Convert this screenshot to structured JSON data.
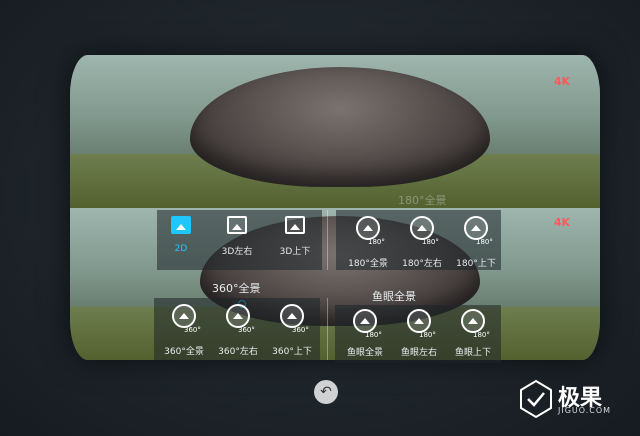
{
  "video": {
    "badge_top": "4K",
    "badge_bottom": "4K"
  },
  "menu_2d_3d": {
    "items": [
      {
        "label": "2D",
        "active": true
      },
      {
        "label": "3D左右",
        "active": false
      },
      {
        "label": "3D上下",
        "active": false
      }
    ]
  },
  "menu_180": {
    "ghost_title": "180°全景",
    "items": [
      {
        "label": "180°全景",
        "icon_tag": "180°"
      },
      {
        "label": "180°左右",
        "icon_tag": "180°"
      },
      {
        "label": "180°上下",
        "icon_tag": "180°"
      }
    ]
  },
  "menu_360": {
    "title": "360°全景",
    "items": [
      {
        "label": "360°全景",
        "icon_tag": "360°"
      },
      {
        "label": "360°左右",
        "icon_tag": "360°"
      },
      {
        "label": "360°上下",
        "icon_tag": "360°"
      }
    ]
  },
  "menu_fisheye": {
    "title": "鱼眼全景",
    "items": [
      {
        "label": "鱼眼全景",
        "icon_tag": "180°"
      },
      {
        "label": "鱼眼左右",
        "icon_tag": "180°"
      },
      {
        "label": "鱼眼上下",
        "icon_tag": "180°"
      }
    ]
  },
  "back_button": {
    "icon": "undo-icon",
    "glyph": "↶"
  },
  "watermark": {
    "text": "极果",
    "sub": "JIGUO.COM"
  },
  "colors": {
    "accent": "#1ec8ff",
    "badge": "#ff5a5a"
  }
}
